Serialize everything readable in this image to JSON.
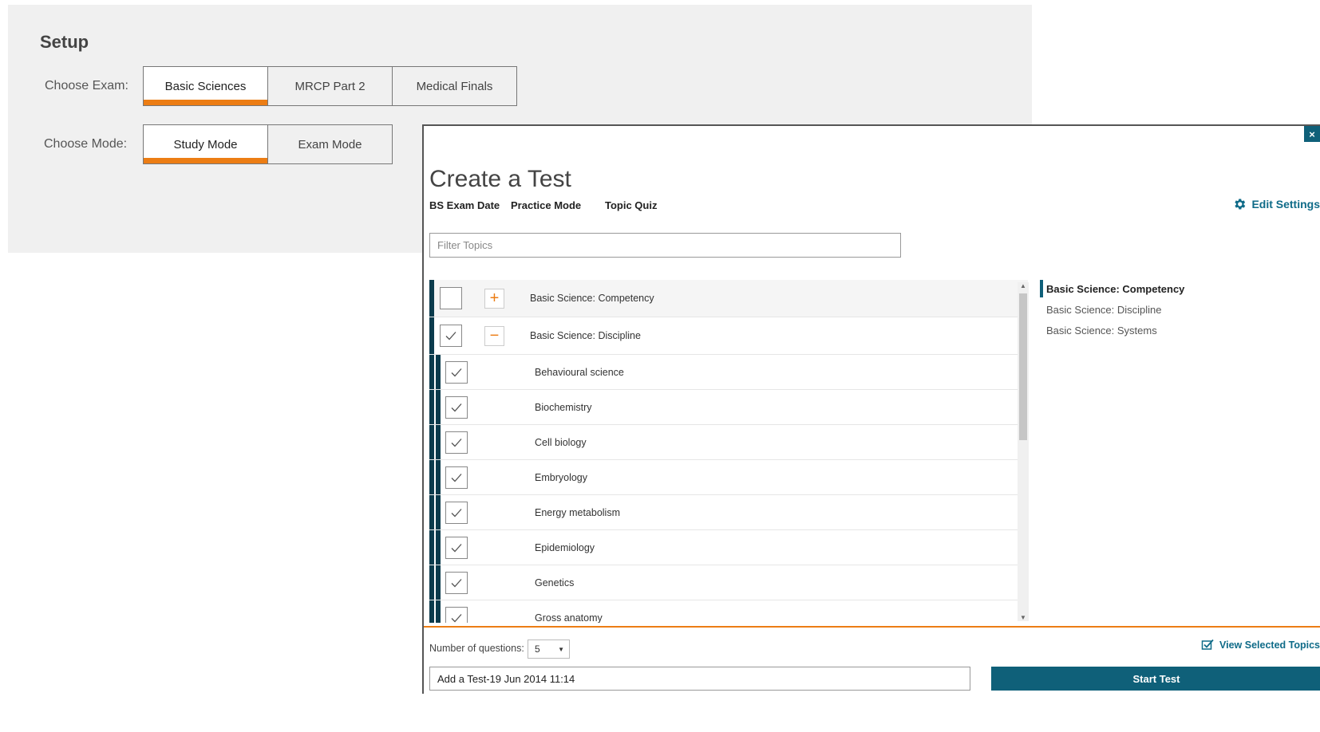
{
  "setup": {
    "title": "Setup",
    "exam_label": "Choose Exam:",
    "exams": [
      "Basic Sciences",
      "MRCP Part 2",
      "Medical Finals"
    ],
    "selected_exam": "Basic Sciences",
    "mode_label": "Choose Mode:",
    "modes": [
      "Study Mode",
      "Exam Mode"
    ],
    "selected_mode": "Study Mode"
  },
  "modal": {
    "close_label": "×",
    "title": "Create a Test",
    "meta": [
      "BS Exam Date",
      "Practice Mode",
      "Topic Quiz"
    ],
    "edit_settings": "Edit Settings",
    "filter_placeholder": "Filter Topics",
    "groups": [
      {
        "label": "Basic Science: Competency",
        "checked": false,
        "expander": "+"
      },
      {
        "label": "Basic Science: Discipline",
        "checked": true,
        "expander": "−"
      }
    ],
    "topics": [
      "Behavioural science",
      "Biochemistry",
      "Cell biology",
      "Embryology",
      "Energy metabolism",
      "Epidemiology",
      "Genetics",
      "Gross anatomy"
    ],
    "side_nav": [
      "Basic Science: Competency",
      "Basic Science: Discipline",
      "Basic Science: Systems"
    ],
    "questions_label": "Number of questions:",
    "questions_value": "5",
    "view_selected": "View Selected Topics",
    "test_name": "Add a Test-19 Jun 2014 11:14",
    "start_label": "Start Test"
  },
  "colors": {
    "accent": "#ec7d14",
    "primary": "#0f6079",
    "bar": "#0b3b4c"
  }
}
